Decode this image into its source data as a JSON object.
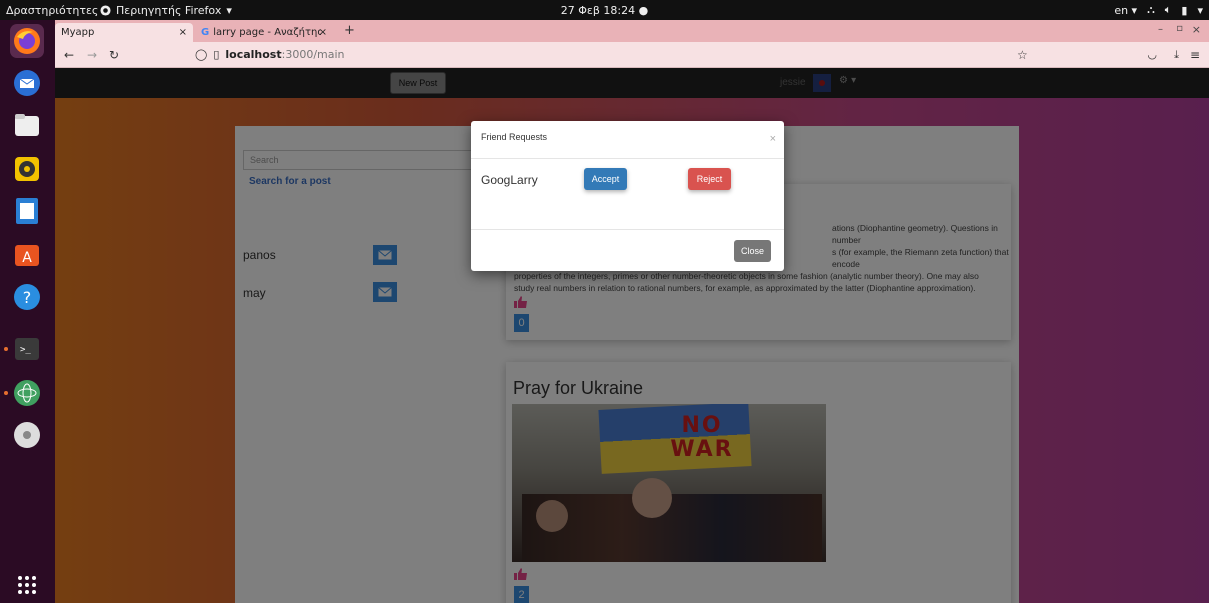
{
  "system": {
    "activities": "Δραστηριότητες",
    "app_menu": "Περιηγητής Firefox",
    "clock": "27 Φεβ 18:24",
    "lang": "en"
  },
  "browser": {
    "tabs": [
      {
        "label": "Myapp",
        "close": "×"
      },
      {
        "label": "larry page - Αναζήτηση G",
        "close": "×"
      }
    ],
    "new_tab": "+",
    "url_host": "localhost",
    "url_path": ":3000/main"
  },
  "app": {
    "new_post_label": "New Post",
    "username": "jessie",
    "search_placeholder": "Search",
    "search_link": "Search for a post",
    "friends": [
      {
        "name": "panos"
      },
      {
        "name": "may"
      }
    ],
    "posts": [
      {
        "text_lines": [
          "ations (Diophantine geometry). Questions in number",
          "s (for example, the Riemann zeta function) that encode",
          "properties of the integers, primes or other number-theoretic objects in some fashion (analytic number theory). One may also",
          "study real numbers in relation to rational numbers, for example, as approximated by the latter (Diophantine approximation)."
        ],
        "likes": "0"
      },
      {
        "title": "Pray for Ukraine",
        "image_text": "NO WAR",
        "likes": "2"
      }
    ]
  },
  "modal": {
    "title": "Friend Requests",
    "close_x": "×",
    "request_name": "GoogLarry",
    "accept_label": "Accept",
    "reject_label": "Reject",
    "close_label": "Close"
  },
  "colors": {
    "accept": "#337ab7",
    "reject": "#d9534f",
    "close": "#777777",
    "like": "#e8458b",
    "count": "#3a8ee0"
  }
}
